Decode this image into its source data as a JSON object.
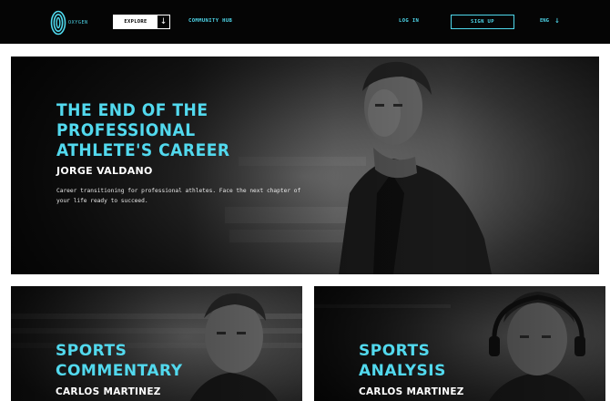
{
  "colors": {
    "accent": "#4fd8ec",
    "nav_bg": "#050505",
    "page_bg": "#ffffff"
  },
  "header": {
    "logo_text": "OXYGEN",
    "explore_label": "EXPLORE",
    "explore_icon": "arrow-down-icon",
    "community_label": "COMMUNITY HUB",
    "login_label": "LOG IN",
    "signup_label": "SIGN UP",
    "language_label": "ENG",
    "language_icon": "arrow-down-icon"
  },
  "hero": {
    "title": "THE END OF THE PROFESSIONAL ATHLETE'S CAREER",
    "name": "JORGE VALDANO",
    "description": "Career transitioning for professional athletes. Face the next chapter of your life ready to succeed."
  },
  "cards": [
    {
      "title_line1": "SPORTS",
      "title_line2": "COMMENTARY",
      "name": "CARLOS MARTINEZ"
    },
    {
      "title_line1": "SPORTS",
      "title_line2": "ANALYSIS",
      "name": "CARLOS MARTINEZ"
    }
  ]
}
